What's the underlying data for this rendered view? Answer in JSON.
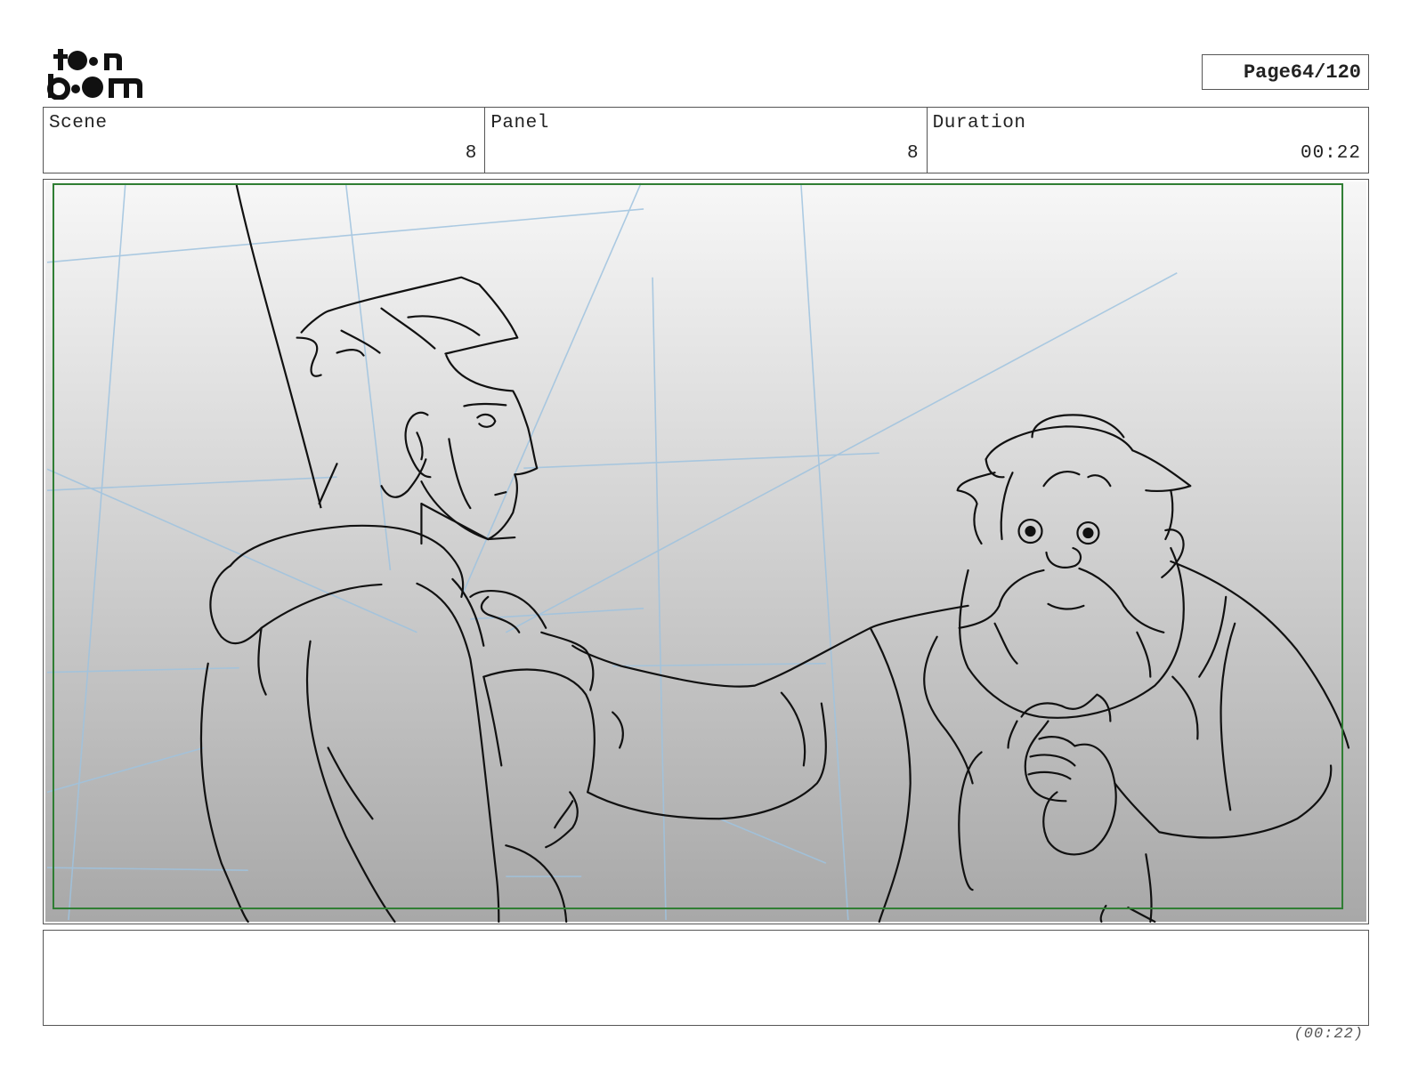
{
  "logo": {
    "line1": "toon",
    "line2": "boom"
  },
  "page": {
    "label": "Page",
    "value": "64/120"
  },
  "header": {
    "scene_label": "Scene",
    "scene_value": "8",
    "panel_label": "Panel",
    "panel_value": "8",
    "duration_label": "Duration",
    "duration_value": "00:22"
  },
  "panel": {
    "image": "storyboard-sketch",
    "safe_frame_color": "#2e7d32"
  },
  "footer": {
    "duration": "(00:22)"
  }
}
